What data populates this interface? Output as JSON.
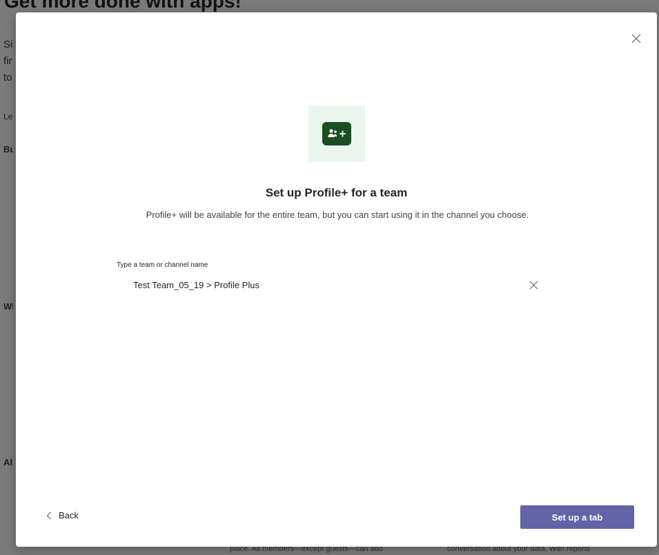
{
  "background": {
    "title": "Get more done with apps!",
    "fragments": [
      "Si",
      "fir",
      "to",
      "Le",
      "Bu",
      "Wl",
      "All"
    ],
    "bottom_left": "place. All members—except guests—can add",
    "bottom_right": "conversation about your data. With reports"
  },
  "dialog": {
    "close_icon": "close-icon",
    "app_icon": "people-add-icon",
    "title": "Set up Profile+ for a team",
    "description": "Profile+ will be available for the entire team, but you can start using it in the channel you choose.",
    "field_label": "Type a team or channel name",
    "field_value": "Test Team_05_19 > Profile Plus",
    "back_label": "Back",
    "primary_label": "Set up a tab"
  },
  "colors": {
    "primary": "#6264a7",
    "icon_bg": "#1b4e22",
    "icon_tile": "#eaf5ee"
  }
}
